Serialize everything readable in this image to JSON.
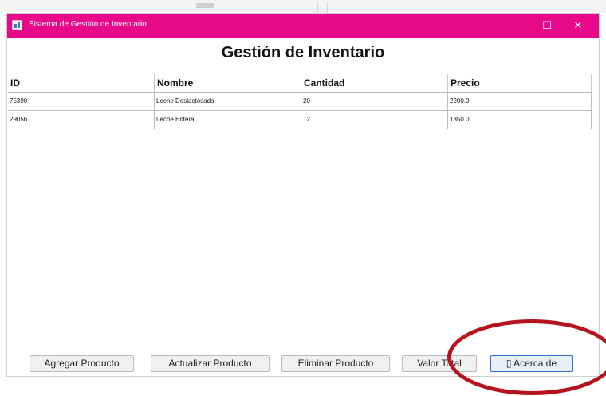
{
  "window": {
    "title": "Sistema de Gestión de Inventario",
    "controls": {
      "minimize": "—",
      "maximize": "☐",
      "close": "✕"
    },
    "accent_color": "#e8088a"
  },
  "heading": "Gestión de Inventario",
  "table": {
    "columns": [
      "ID",
      "Nombre",
      "Cantidad",
      "Precio"
    ],
    "rows": [
      [
        "75390",
        "Leche Deslactosada",
        "20",
        "2200.0"
      ],
      [
        "29056",
        "Leche Entera",
        "12",
        "1850.0"
      ]
    ]
  },
  "buttons": {
    "agregar": "Agregar Producto",
    "actualizar": "Actualizar Producto",
    "eliminar": "Eliminar Producto",
    "valor_total": "Valor Total",
    "acerca": "▯ Acerca de"
  },
  "annotation_color": "#b5121b"
}
